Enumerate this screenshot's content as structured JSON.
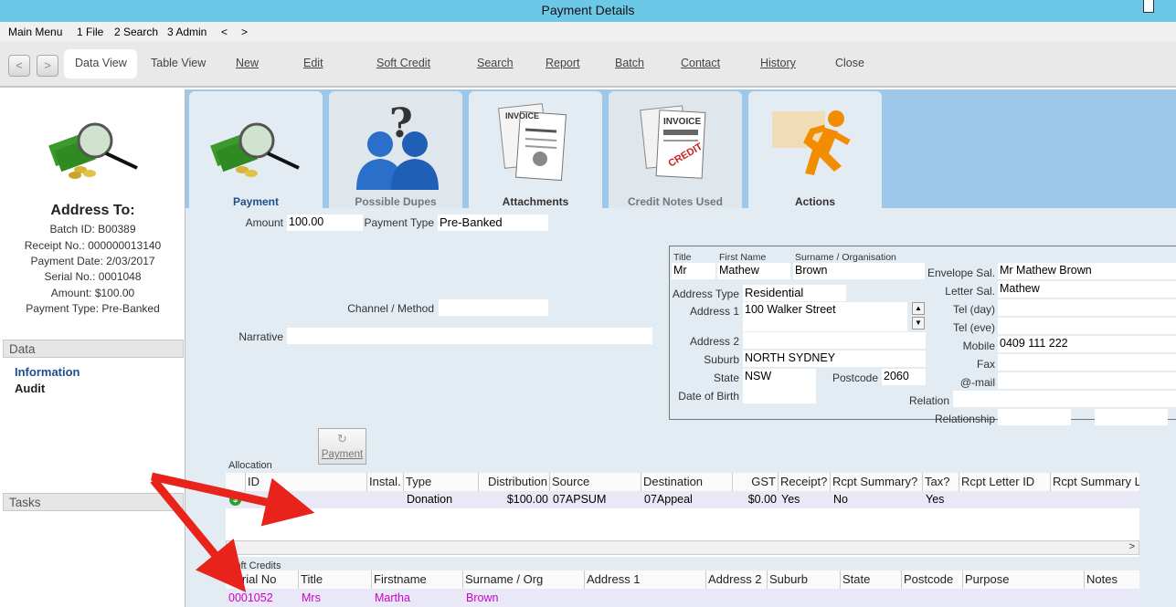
{
  "window": {
    "title": "Payment Details"
  },
  "menu": {
    "items": [
      "Main Menu",
      "1 File",
      "2 Search",
      "3 Admin",
      "<",
      ">"
    ]
  },
  "toolbar": {
    "back": "<",
    "forward": ">",
    "data_view": "Data View",
    "table_view": "Table View",
    "new": "New",
    "edit": "Edit",
    "soft_credit": "Soft Credit",
    "search": "Search",
    "report": "Report",
    "batch": "Batch",
    "contact": "Contact",
    "history": "History",
    "close": "Close"
  },
  "sidebar": {
    "address_to": "Address To:",
    "batch_id": "Batch ID: B00389",
    "receipt_no": "Receipt No.: 000000013140",
    "payment_date": "Payment Date: 2/03/2017",
    "serial_no": "Serial No.: 0001048",
    "amount": "Amount: $100.00",
    "payment_type": "Payment Type: Pre-Banked",
    "data_header": "Data",
    "data_items": [
      "Information",
      "Audit"
    ],
    "tasks_header": "Tasks"
  },
  "tabs": [
    {
      "label": "Payment",
      "state": "active",
      "icon": "money-magnifier-icon"
    },
    {
      "label": "Possible Dupes",
      "state": "disabled",
      "icon": "people-question-icon"
    },
    {
      "label": "Attachments",
      "state": "normal",
      "icon": "invoice-pin-icon"
    },
    {
      "label": "Credit Notes Used",
      "state": "disabled",
      "icon": "credit-invoice-icon"
    },
    {
      "label": "Actions",
      "state": "normal",
      "icon": "running-man-icon"
    }
  ],
  "form": {
    "amount_label": "Amount",
    "amount": "100.00",
    "payment_type_label": "Payment Type",
    "payment_type": "Pre-Banked",
    "channel_label": "Channel / Method",
    "channel": "",
    "narrative_label": "Narrative",
    "narrative": ""
  },
  "contact": {
    "title_label": "Title",
    "title": "Mr",
    "first_label": "First Name",
    "first": "Mathew",
    "surname_label": "Surname / Organisation",
    "surname": "Brown",
    "address_type_label": "Address Type",
    "address_type": "Residential",
    "address1_label": "Address 1",
    "address1": "100 Walker Street",
    "address2_label": "Address 2",
    "address2": "",
    "suburb_label": "Suburb",
    "suburb": "NORTH SYDNEY",
    "state_label": "State",
    "state": "NSW",
    "postcode_label": "Postcode",
    "postcode": "2060",
    "dob_label": "Date of Birth",
    "dob": "",
    "envelope_label": "Envelope Sal.",
    "envelope": "Mr Mathew Brown",
    "letter_label": "Letter Sal.",
    "letter": "Mathew",
    "tel_day_label": "Tel (day)",
    "tel_day": "",
    "tel_eve_label": "Tel (eve)",
    "tel_eve": "",
    "mobile_label": "Mobile",
    "mobile": "0409 111 222",
    "fax_label": "Fax",
    "fax": "",
    "email_label": "@-mail",
    "email": "",
    "relation_label": "Relation",
    "relation": "",
    "relationship_label": "Relationship",
    "relationship": ""
  },
  "payment_button": "Payment",
  "allocation": {
    "label": "Allocation",
    "headers": [
      "ID",
      "Instal.",
      "Type",
      "Distribution",
      "Source",
      "Destination",
      "GST",
      "Receipt?",
      "Rcpt Summary?",
      "Tax?",
      "Rcpt Letter ID",
      "Rcpt Summary L"
    ],
    "row": [
      "",
      "",
      "Donation",
      "$100.00",
      "07APSUM",
      "07Appeal",
      "$0.00",
      "Yes",
      "No",
      "Yes",
      "",
      ""
    ]
  },
  "soft_credits": {
    "label": "Soft Credits",
    "headers": [
      "Serial No",
      "Title",
      "Firstname",
      "Surname / Org",
      "Address 1",
      "Address 2",
      "Suburb",
      "State",
      "Postcode",
      "Purpose",
      "Notes"
    ],
    "row": [
      "0001052",
      "Mrs",
      "Martha",
      "Brown",
      "",
      "",
      "",
      "",
      "",
      "",
      ""
    ],
    "row_color": "#cc00cc"
  },
  "colors": {
    "titlebar": "#6dc8e8",
    "tabstrip": "#9ec8ea",
    "accent": "#1e4f8c",
    "arrow": "#e8231b"
  }
}
